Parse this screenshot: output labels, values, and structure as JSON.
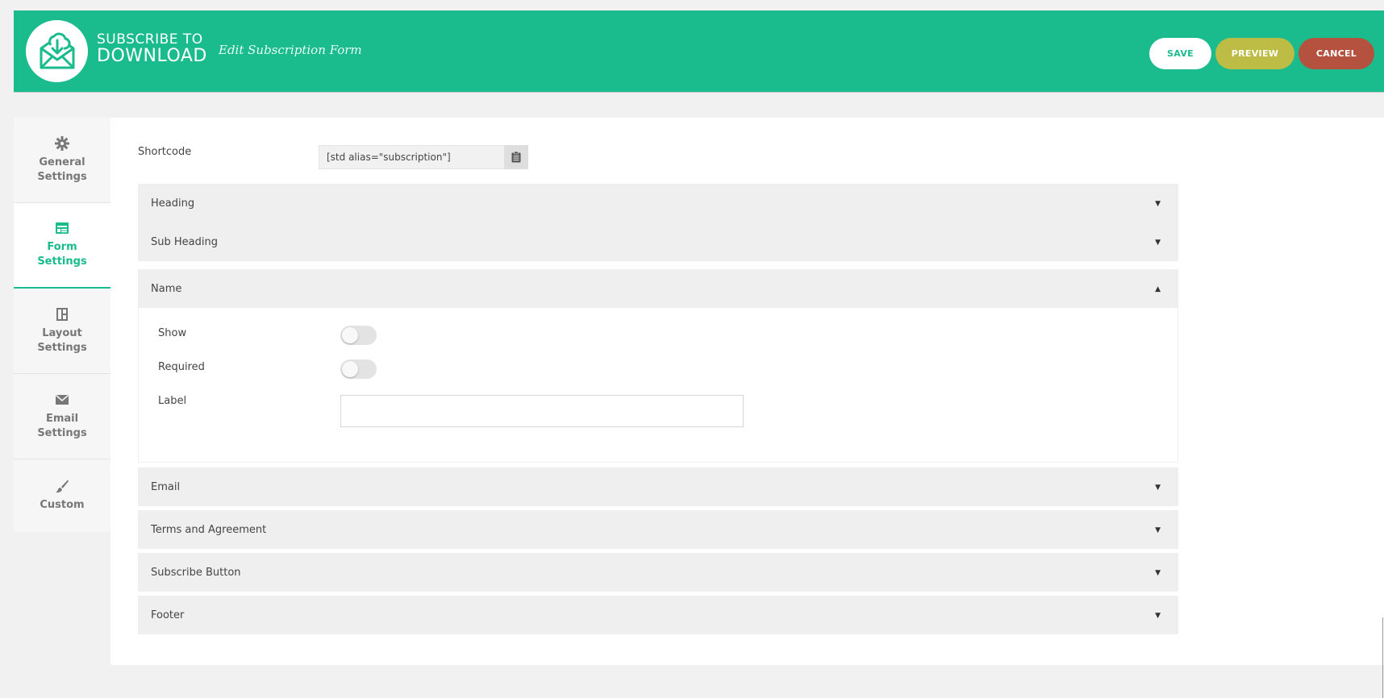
{
  "header": {
    "brand_line1": "SUBSCRIBE TO",
    "brand_line2": "DOWNLOAD",
    "subtitle": "Edit Subscription Form",
    "save_label": "SAVE",
    "preview_label": "PREVIEW",
    "cancel_label": "CANCEL",
    "colors": {
      "bar": "#1abb8c",
      "preview": "#bdbd45",
      "cancel": "#b5523f"
    }
  },
  "sidebar": {
    "items": [
      {
        "label": "General Settings",
        "line1": "General",
        "line2": "Settings",
        "icon": "gear-icon"
      },
      {
        "label": "Form Settings",
        "line1": "Form",
        "line2": "Settings",
        "icon": "form-icon",
        "active": true
      },
      {
        "label": "Layout Settings",
        "line1": "Layout",
        "line2": "Settings",
        "icon": "layout-icon"
      },
      {
        "label": "Email Settings",
        "line1": "Email",
        "line2": "Settings",
        "icon": "envelope-icon"
      },
      {
        "label": "Custom",
        "line1": "Custom",
        "line2": "",
        "icon": "brush-icon"
      }
    ]
  },
  "main": {
    "shortcode_label": "Shortcode",
    "shortcode_value": "[std alias=\"subscription\"]",
    "sections": [
      {
        "title": "Heading",
        "expanded": false
      },
      {
        "title": "Sub Heading",
        "expanded": false
      },
      {
        "title": "Name",
        "expanded": true
      },
      {
        "title": "Email",
        "expanded": false
      },
      {
        "title": "Terms and Agreement",
        "expanded": false
      },
      {
        "title": "Subscribe Button",
        "expanded": false
      },
      {
        "title": "Footer",
        "expanded": false
      }
    ],
    "name_section": {
      "show_label": "Show",
      "show_value": false,
      "required_label": "Required",
      "required_value": false,
      "label_label": "Label",
      "label_value": ""
    }
  }
}
